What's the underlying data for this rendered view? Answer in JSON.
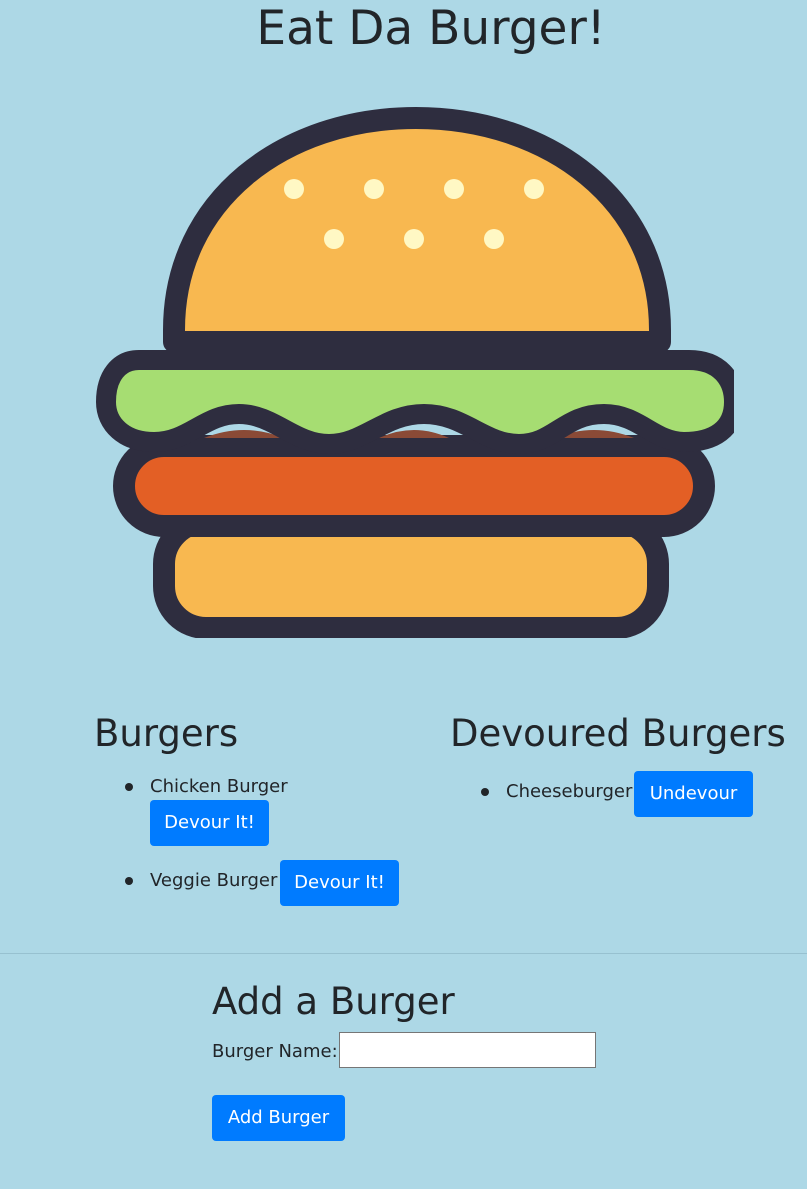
{
  "header": {
    "title": "Eat Da Burger!"
  },
  "hero": {
    "image_icon": "hamburger-illustration",
    "colors": {
      "outline": "#2e2d3f",
      "bun": "#f8b850",
      "seeds": "#fff8c4",
      "lettuce": "#a6dd72",
      "patty": "#e35f25",
      "sauce": "#8a4a36"
    }
  },
  "burgers": {
    "title": "Burgers",
    "items": [
      {
        "name": "Chicken Burger",
        "button": "Devour It!"
      },
      {
        "name": "Veggie Burger",
        "button": "Devour It!"
      }
    ]
  },
  "devoured": {
    "title": "Devoured Burgers",
    "items": [
      {
        "name": "Cheeseburger",
        "button": "Undevour"
      }
    ]
  },
  "add_form": {
    "title": "Add a Burger",
    "label": "Burger Name:",
    "input_value": "",
    "input_placeholder": "",
    "submit_label": "Add Burger"
  },
  "theme": {
    "background": "#add8e6",
    "button": "#007bff",
    "text": "#212529"
  }
}
